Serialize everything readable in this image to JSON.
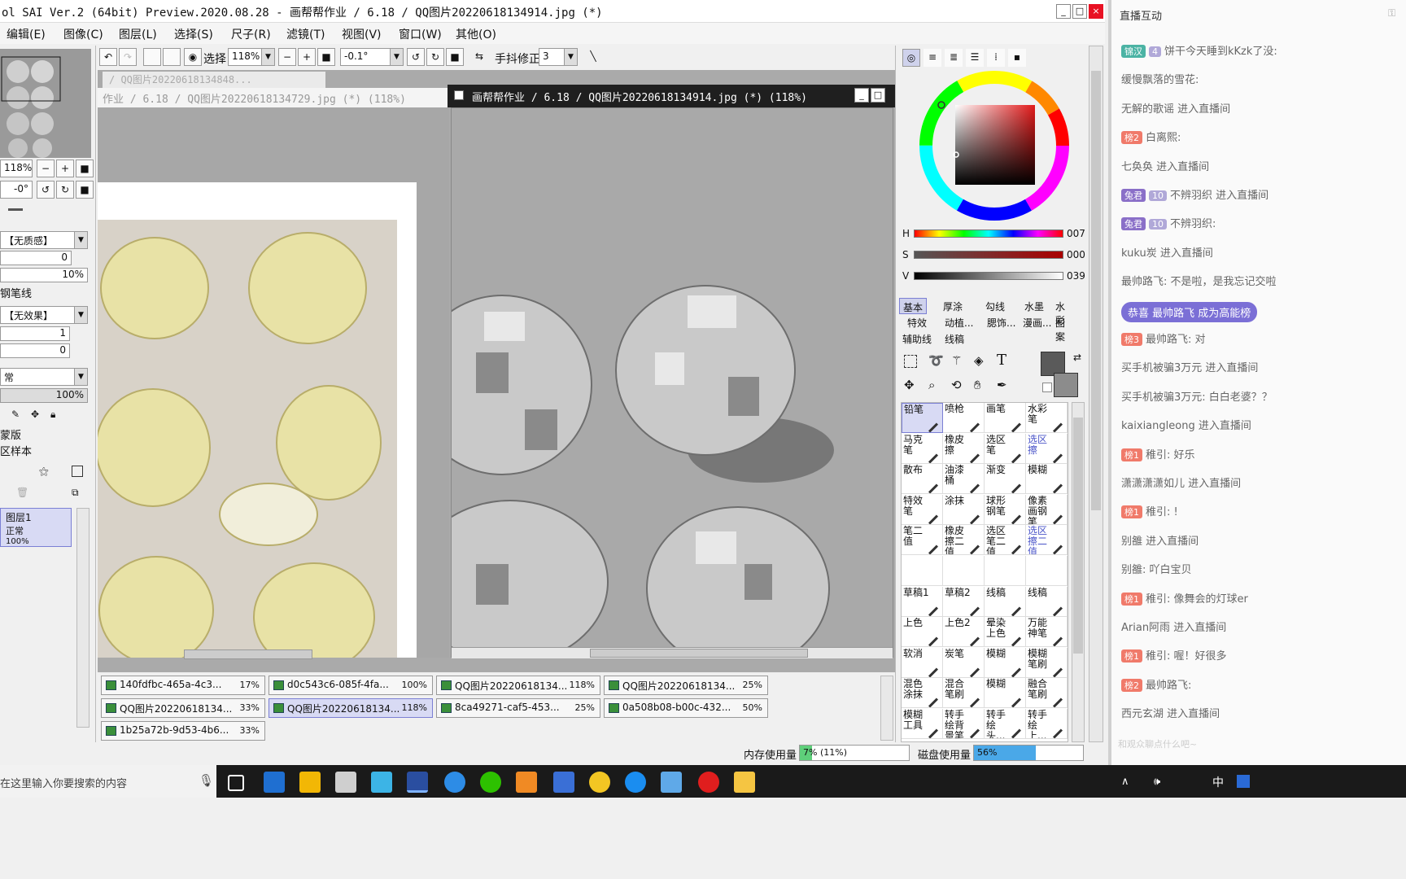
{
  "titlebar": {
    "title": "ol SAI Ver.2 (64bit) Preview.2020.08.28 - 画帮帮作业 / 6.18 / QQ图片20220618134914.jpg (*)",
    "minimize": "_",
    "maximize": "□",
    "close": "×"
  },
  "menu": [
    "编辑(E)",
    "图像(C)",
    "图层(L)",
    "选择(S)",
    "尺子(R)",
    "滤镜(T)",
    "视图(V)",
    "窗口(W)",
    "其他(O)"
  ],
  "toolbar": {
    "select_label": "选择",
    "zoom_value": "118%",
    "angle_value": "-0.1°",
    "stabilizer_label": "手抖修正",
    "stabilizer_value": "3"
  },
  "left": {
    "zoom": "118%",
    "angle": "-0°",
    "texture": "【无质感】",
    "texture_value": "0",
    "texture_pct": "10%",
    "line_label": "钢笔线",
    "effect": "【无效果】",
    "effect_v1": "1",
    "effect_v2": "0",
    "blend": "常",
    "opacity": "100%",
    "mask_label": "蒙版",
    "sample_label": "区样本",
    "layer_name": "图层1",
    "layer_mode": "正常",
    "layer_opacity": "100%"
  },
  "doc_left": {
    "title_inactive": "/ QQ图片20220618134848...",
    "title": "作业 / 6.18 / QQ图片20220618134729.jpg (*) (118%)"
  },
  "doc_right": {
    "title": "画帮帮作业 / 6.18 / QQ图片20220618134914.jpg (*) (118%)"
  },
  "tabs": [
    {
      "name": "140fdfbc-465a-4c3...",
      "pct": "17%"
    },
    {
      "name": "d0c543c6-085f-4fa...",
      "pct": "100%"
    },
    {
      "name": "QQ图片20220618134...",
      "pct": "118%"
    },
    {
      "name": "QQ图片20220618134...",
      "pct": "25%"
    },
    {
      "name": "QQ图片20220618134...",
      "pct": "33%"
    },
    {
      "name": "QQ图片20220618134...",
      "pct": "118%"
    },
    {
      "name": "8ca49271-caf5-453...",
      "pct": "25%"
    },
    {
      "name": "0a508b08-b00c-432...",
      "pct": "50%"
    },
    {
      "name": "1b25a72b-9d53-4b6...",
      "pct": "33%"
    }
  ],
  "color": {
    "h_label": "H",
    "h_value": "007",
    "s_label": "S",
    "s_value": "000",
    "v_label": "V",
    "v_value": "039",
    "main": "#5a5a5a",
    "sub": "#8c8c8c"
  },
  "brush_categories": [
    "基本",
    "厚涂",
    "勾线",
    "水墨",
    "水彩",
    "特效",
    "动植...",
    "腮饰...",
    "漫画...",
    "图案",
    "辅助线",
    "线稿"
  ],
  "brushes": [
    "铅笔",
    "喷枪",
    "画笔",
    "水彩笔",
    "马克笔",
    "橡皮擦",
    "选区笔",
    "选区擦",
    "散布",
    "油漆桶",
    "渐变",
    "模糊",
    "特效笔",
    "涂抹",
    "球形钢笔",
    "像素画钢笔",
    "笔二值",
    "橡皮擦二值",
    "选区笔二值",
    "选区擦二值",
    "",
    "",
    "",
    "",
    "草稿1",
    "草稿2",
    "线稿",
    "线稿",
    "上色",
    "上色2",
    "晕染上色",
    "万能神笔",
    "软消",
    "炭笔",
    "模糊",
    "模糊笔刷",
    "混色涂抹",
    "混合笔刷",
    "模糊",
    "融合笔刷",
    "模糊工具",
    "转手绘背景笔",
    "转手绘头...",
    "转手绘上..."
  ],
  "status": {
    "mem_label": "内存使用量",
    "mem_value": "7% (11%)",
    "disk_label": "磁盘使用量",
    "disk_value": "56%"
  },
  "chat": {
    "header": "直播互动",
    "messages": [
      {
        "badge": "锦汉",
        "lvl": "4",
        "text": "饼干今天睡到kKzk了没:"
      },
      {
        "badge": "",
        "lvl": "",
        "text": "缓慢飘落的雪花:"
      },
      {
        "badge": "",
        "lvl": "",
        "text": "无解的歌谣 进入直播间"
      },
      {
        "badge": "榜2",
        "lvl": "",
        "text": "白离熙:"
      },
      {
        "badge": "",
        "lvl": "",
        "text": "七奂奂 进入直播间"
      },
      {
        "badge": "兔君",
        "lvl": "10",
        "text": "不辨羽织 进入直播间"
      },
      {
        "badge": "兔君",
        "lvl": "10",
        "text": "不辨羽织:"
      },
      {
        "badge": "",
        "lvl": "",
        "text": "kuku炭 进入直播间"
      },
      {
        "badge": "",
        "lvl": "",
        "text": "最帅路飞: 不是啦，是我忘记交啦"
      },
      {
        "badge": "",
        "lvl": "",
        "text": "恭喜 最帅路飞 成为高能榜"
      },
      {
        "badge": "榜3",
        "lvl": "",
        "text": "最帅路飞: 对"
      },
      {
        "badge": "",
        "lvl": "",
        "text": "买手机被骗3万元 进入直播间"
      },
      {
        "badge": "",
        "lvl": "",
        "text": "买手机被骗3万元: 白白老婆？？"
      },
      {
        "badge": "",
        "lvl": "",
        "text": "kaixiangleong 进入直播间"
      },
      {
        "badge": "榜1",
        "lvl": "",
        "text": "稚引: 好乐"
      },
      {
        "badge": "",
        "lvl": "",
        "text": "潇潇潇潇如儿 进入直播间"
      },
      {
        "badge": "榜1",
        "lvl": "",
        "text": "稚引: !"
      },
      {
        "badge": "",
        "lvl": "",
        "text": "别雒 进入直播间"
      },
      {
        "badge": "",
        "lvl": "",
        "text": "别雒: 吖白宝贝"
      },
      {
        "badge": "榜1",
        "lvl": "",
        "text": "稚引: 像舞会的灯球er"
      },
      {
        "badge": "",
        "lvl": "",
        "text": "Arian阿雨 进入直播间"
      },
      {
        "badge": "榜1",
        "lvl": "",
        "text": "稚引: 喔！好很多"
      },
      {
        "badge": "榜2",
        "lvl": "",
        "text": "最帅路飞:"
      },
      {
        "badge": "",
        "lvl": "",
        "text": "西元玄湖 进入直播间"
      }
    ],
    "input_placeholder": "和观众聊点什么吧~"
  },
  "taskbar": {
    "search_placeholder": "在这里输入你要搜索的内容",
    "ime": "中"
  }
}
